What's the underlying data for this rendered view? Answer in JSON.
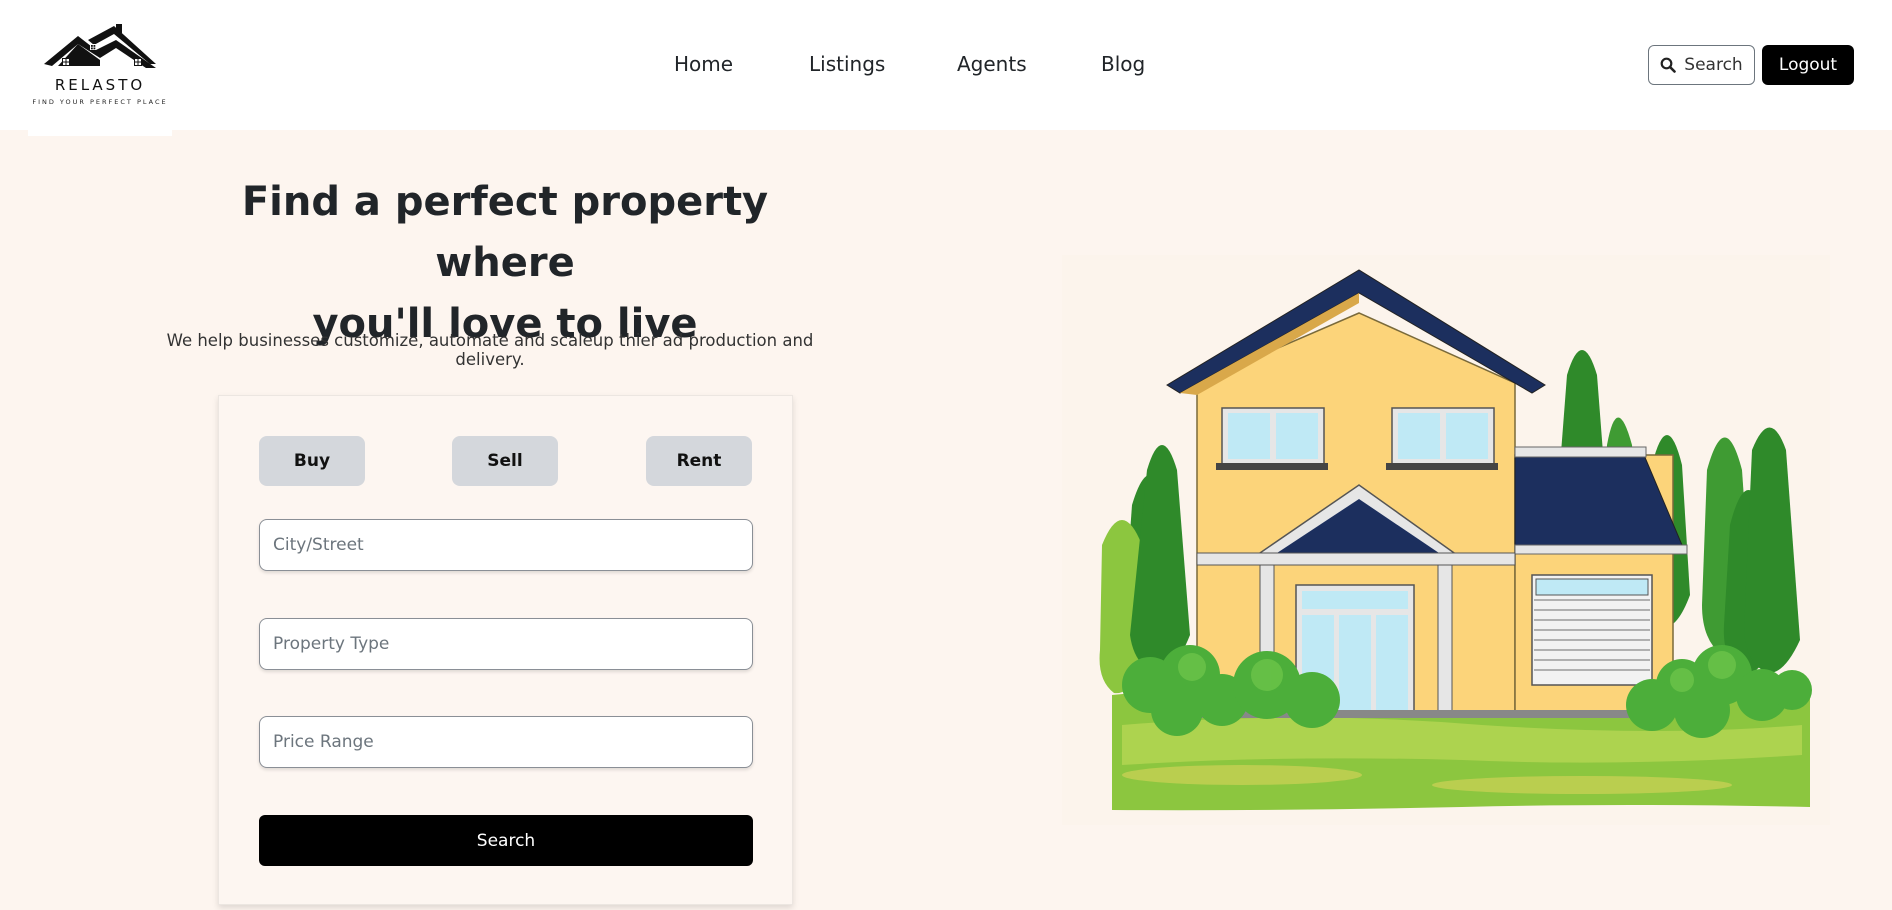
{
  "header": {
    "logo": {
      "name": "RELASTO",
      "tagline": "FIND YOUR PERFECT PLACE",
      "icon": "house-roof-icon"
    },
    "nav": [
      "Home",
      "Listings",
      "Agents",
      "Blog"
    ],
    "search_label": "Search",
    "search_icon": "search-icon",
    "logout_label": "Logout"
  },
  "hero": {
    "title_line1": "Find a perfect property where",
    "title_line2": "you'll love to live",
    "subtitle": "We help businesses customize, automate and scaleup thier ad production and delivery."
  },
  "search_card": {
    "tabs": [
      "Buy",
      "Sell",
      "Rent"
    ],
    "fields": [
      {
        "placeholder": "City/Street",
        "value": ""
      },
      {
        "placeholder": "Property Type",
        "value": ""
      },
      {
        "placeholder": "Price Range",
        "value": ""
      }
    ],
    "search_label": "Search"
  },
  "illustration": {
    "icon": "house-illustration"
  },
  "colors": {
    "page_bg": "#fdf5ef",
    "header_bg": "#ffffff",
    "primary": "#000000",
    "tab_bg": "#d4d7dc",
    "roof": "#1c2f5e",
    "wall": "#fcd47a",
    "tree": "#2f8a2a",
    "grass": "#8cc63f"
  }
}
